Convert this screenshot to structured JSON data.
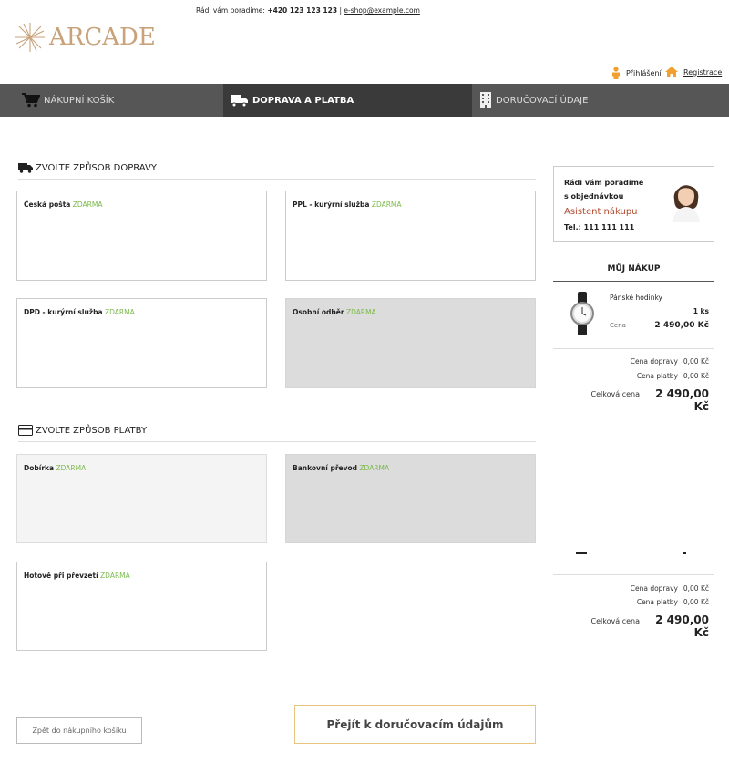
{
  "header": {
    "contact_prefix": "Rádi vám poradíme:",
    "phone": "+420 123 123 123",
    "separator": " | ",
    "email": "e-shop@example.com",
    "logo_text": "ARCADE",
    "login_label": "Přihlášení",
    "register_label": "Registrace"
  },
  "steps": [
    {
      "label": "Nákupní košík"
    },
    {
      "label": "Doprava a platba"
    },
    {
      "label": "Doručovací údaje"
    }
  ],
  "shipping": {
    "title": "Zvolte způsob dopravy",
    "options": [
      {
        "name": "Česká pošta",
        "price": "ZDARMA"
      },
      {
        "name": "PPL - kurýrní služba",
        "price": "ZDARMA"
      },
      {
        "name": "DPD - kurýrní služba",
        "price": "ZDARMA"
      },
      {
        "name": "Osobní odběr",
        "price": "ZDARMA"
      }
    ]
  },
  "payment": {
    "title": "Zvolte způsob platby",
    "options": [
      {
        "name": "Dobírka",
        "price": "ZDARMA"
      },
      {
        "name": "Bankovní převod",
        "price": "ZDARMA"
      },
      {
        "name": "Hotově při převzetí",
        "price": "ZDARMA"
      }
    ]
  },
  "assistant": {
    "text": "Rádi vám poradíme s objednávkou",
    "name": "Asistent nákupu",
    "phone": "Tel.: 111 111 111"
  },
  "cart": {
    "title": "Můj nákup",
    "item_name": "Pánské hodinky",
    "item_qty": "1 ks",
    "price_label": "Cena",
    "item_price": "2 490,00 Kč",
    "shipping_label": "Cena dopravy",
    "shipping_value": "0,00 Kč",
    "payment_label": "Cena platby",
    "payment_value": "0,00 Kč",
    "total_label": "Celková cena",
    "total_value": "2 490,00 Kč"
  },
  "buttons": {
    "back": "Zpět do nákupního košíku",
    "next": "Přejít k doručovacím údajům"
  },
  "colors": {
    "accent_gold": "#c8a27a",
    "free_green": "#7cba4c",
    "assistant_red": "#b24a2e",
    "active_step": "#3a3a3a",
    "step_bg": "#565656"
  }
}
